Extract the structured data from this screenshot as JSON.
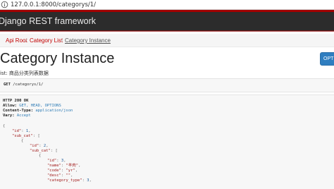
{
  "browser": {
    "url": "127.0.0.1:8000/categorys/1/"
  },
  "navbar": {
    "brand": "Django REST framework"
  },
  "breadcrumb": {
    "items": [
      {
        "label": "Api Root"
      },
      {
        "label": "Category List"
      },
      {
        "label": "Category Instance"
      }
    ],
    "separator": "/"
  },
  "page": {
    "title": "Category Instance",
    "description": "ist: 商品分类列表数据",
    "options_label": "OPTIONS"
  },
  "request": {
    "method": "GET",
    "path": "/categorys/1/"
  },
  "response": {
    "status": "HTTP 200 OK",
    "headers": [
      {
        "name": "Allow:",
        "value": "GET, HEAD, OPTIONS"
      },
      {
        "name": "Content-Type:",
        "value": "application/json"
      },
      {
        "name": "Vary:",
        "value": "Accept"
      }
    ],
    "json": {
      "open_brace": "{",
      "id_key": "\"id\"",
      "id_val": "1",
      "sub_cat_key": "\"sub_cat\"",
      "open_bracket": "[",
      "l2_open_brace": "{",
      "l2_id_key": "\"id\"",
      "l2_id_val": "2",
      "l2_sub_cat_key": "\"sub_cat\"",
      "l2_open_bracket": "[",
      "l3_open_brace": "{",
      "l3_id_key": "\"id\"",
      "l3_id_val": "3",
      "l3_name_key": "\"name\"",
      "l3_name_val": "\"羊肉\"",
      "l3_code_key": "\"code\"",
      "l3_code_val": "\"yr\"",
      "l3_desc_key": "\"desc\"",
      "l3_desc_val": "\"\"",
      "l3_ctype_key": "\"category_type\"",
      "l3_ctype_val": "3"
    }
  },
  "colors": {
    "navbar_bg": "#2c2c2c",
    "accent_red": "#a30000",
    "link_red": "#c20000",
    "button_blue": "#2f7ec0",
    "string_red": "#a11b1b",
    "literal_blue": "#2d7bb5"
  },
  "icons": {
    "address_info": "info-circle-icon"
  }
}
